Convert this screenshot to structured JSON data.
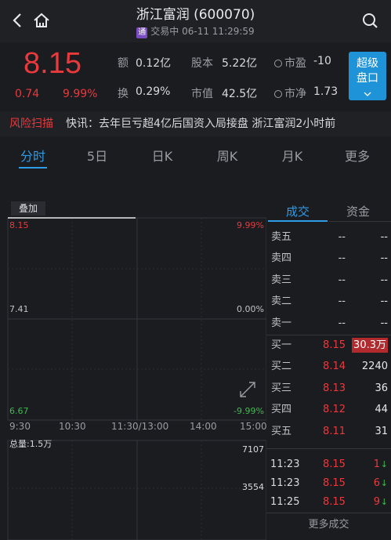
{
  "header": {
    "title": "浙江富润 (600070)",
    "badge": "通",
    "status": "交易中 06-11 11:29:59"
  },
  "quote": {
    "price": "8.15",
    "change": "0.74",
    "change_pct": "9.99%",
    "amount_label": "额",
    "amount": "0.12亿",
    "turnover_label": "换",
    "turnover": "0.29%",
    "shares_label": "股本",
    "shares": "5.22亿",
    "mktcap_label": "市值",
    "mktcap": "42.5亿",
    "pe_label": "市盈",
    "pe": "-10",
    "pb_label": "市净",
    "pb": "1.73",
    "super_btn_line1": "超级",
    "super_btn_line2": "盘口"
  },
  "news": {
    "risk_label": "风险扫描",
    "text": "快讯：去年巨亏超4亿后国资入局接盘 浙江富润2小时前"
  },
  "tabs": [
    "分时",
    "5日",
    "日K",
    "周K",
    "月K",
    "更多"
  ],
  "chart": {
    "overlay_label": "叠加",
    "price_top": "8.15",
    "price_mid": "7.41",
    "price_bot": "6.67",
    "pct_top": "9.99%",
    "pct_mid": "0.00%",
    "pct_bot": "-9.99%",
    "time_ticks": [
      "9:30",
      "10:30",
      "11:30/13:00",
      "14:00",
      "15:00"
    ],
    "volume_label": "总量:1.5万",
    "vol_top": "7107",
    "vol_mid": "3554"
  },
  "panel": {
    "tab_trades": "成交",
    "tab_funds": "资金",
    "asks": [
      {
        "label": "卖五",
        "price": "--",
        "vol": "--"
      },
      {
        "label": "卖四",
        "price": "--",
        "vol": "--"
      },
      {
        "label": "卖三",
        "price": "--",
        "vol": "--"
      },
      {
        "label": "卖二",
        "price": "--",
        "vol": "--"
      },
      {
        "label": "卖一",
        "price": "--",
        "vol": "--"
      }
    ],
    "bids": [
      {
        "label": "买一",
        "price": "8.15",
        "vol": "30.3万"
      },
      {
        "label": "买二",
        "price": "8.14",
        "vol": "2240"
      },
      {
        "label": "买三",
        "price": "8.13",
        "vol": "36"
      },
      {
        "label": "买四",
        "price": "8.12",
        "vol": "44"
      },
      {
        "label": "买五",
        "price": "8.11",
        "vol": "31"
      }
    ],
    "trades": [
      {
        "time": "11:23",
        "price": "8.15",
        "vol": "1"
      },
      {
        "time": "11:23",
        "price": "8.15",
        "vol": "6"
      },
      {
        "time": "11:25",
        "price": "8.15",
        "vol": "9"
      }
    ],
    "more_trades": "更多成交"
  },
  "colors": {
    "up": "#e8393d",
    "down": "#3fb950",
    "accent": "#2d9be6",
    "button": "#1f93d8"
  }
}
